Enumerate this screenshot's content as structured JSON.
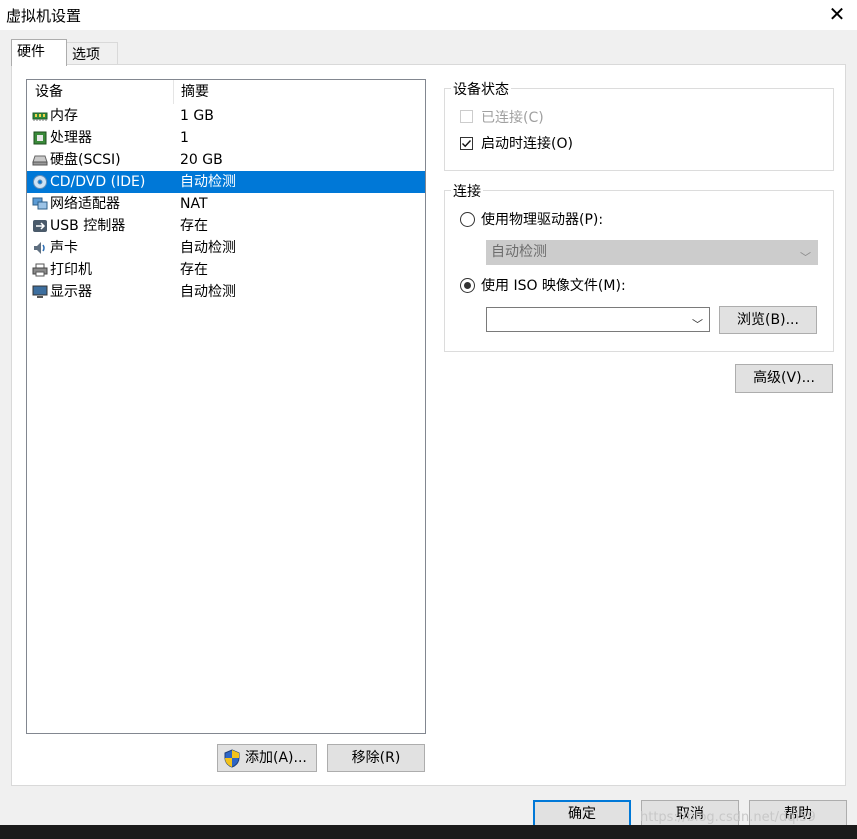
{
  "window": {
    "title": "虚拟机设置",
    "close_symbol": "✕"
  },
  "tabs": [
    {
      "label": "硬件"
    },
    {
      "label": "选项"
    }
  ],
  "device_list": {
    "col_device": "设备",
    "col_summary": "摘要",
    "rows": [
      {
        "device": "内存",
        "summary": "1 GB",
        "icon": "memory-icon"
      },
      {
        "device": "处理器",
        "summary": "1",
        "icon": "processor-icon"
      },
      {
        "device": "硬盘(SCSI)",
        "summary": "20 GB",
        "icon": "hard-disk-icon"
      },
      {
        "device": "CD/DVD (IDE)",
        "summary": "自动检测",
        "icon": "cd-dvd-icon",
        "selected": true
      },
      {
        "device": "网络适配器",
        "summary": "NAT",
        "icon": "network-adapter-icon"
      },
      {
        "device": "USB 控制器",
        "summary": "存在",
        "icon": "usb-icon"
      },
      {
        "device": "声卡",
        "summary": "自动检测",
        "icon": "sound-card-icon"
      },
      {
        "device": "打印机",
        "summary": "存在",
        "icon": "printer-icon"
      },
      {
        "device": "显示器",
        "summary": "自动检测",
        "icon": "display-icon"
      }
    ]
  },
  "add_button": "添加(A)...",
  "remove_button": "移除(R)",
  "device_status": {
    "title": "设备状态",
    "connected": {
      "label": "已连接(C)",
      "checked": false,
      "disabled": true
    },
    "connect_at_power_on": {
      "label": "启动时连接(O)",
      "checked": true
    }
  },
  "connection": {
    "title": "连接",
    "physical_drive": {
      "label": "使用物理驱动器(P):",
      "selected": false,
      "select_value": "自动检测"
    },
    "iso_image": {
      "label": "使用 ISO 映像文件(M):",
      "selected": true,
      "path_value": ""
    },
    "browse_button": "浏览(B)..."
  },
  "advanced_button": "高级(V)...",
  "footer": {
    "ok": "确定",
    "cancel": "取消",
    "help": "帮助"
  },
  "watermark": "https://blog.csdn.net/dqi59",
  "colors": {
    "selection": "#0078d7",
    "default_button_border": "#0078d7"
  }
}
